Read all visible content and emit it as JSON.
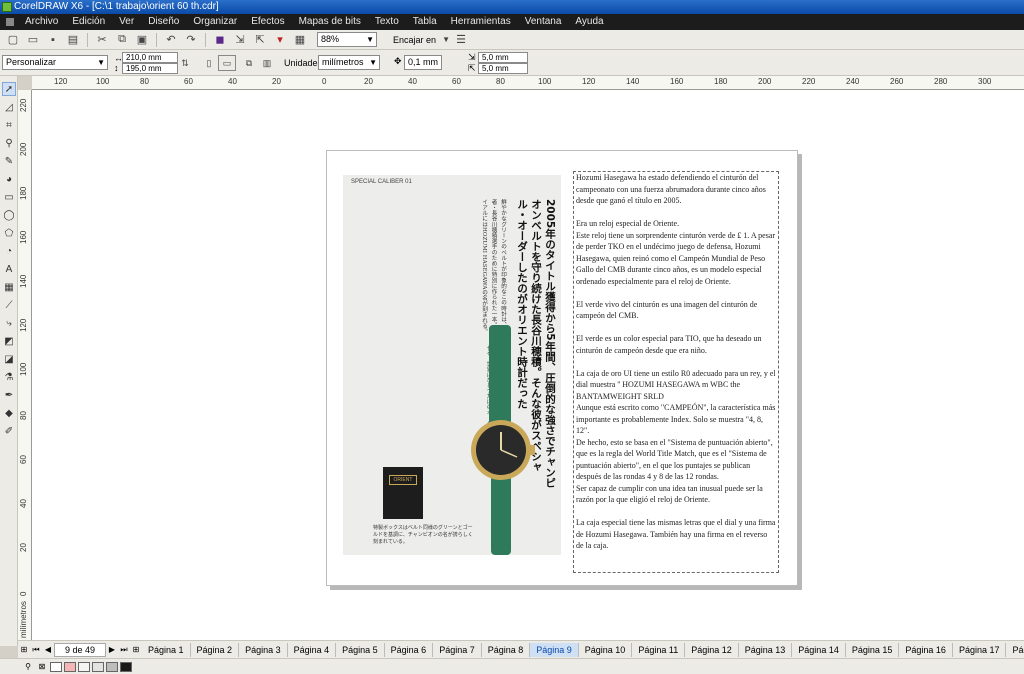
{
  "window": {
    "title": "CorelDRAW X6 - [C:\\1 trabajo\\orient 60 th.cdr]"
  },
  "menu": {
    "items": [
      "Archivo",
      "Edición",
      "Ver",
      "Diseño",
      "Organizar",
      "Efectos",
      "Mapas de bits",
      "Texto",
      "Tabla",
      "Herramientas",
      "Ventana",
      "Ayuda"
    ]
  },
  "toolbar": {
    "zoom": "88%",
    "snap_label": "Encajar en"
  },
  "property_bar": {
    "preset": "Personalizar",
    "width": "210,0 mm",
    "height": "195,0 mm",
    "units_label": "Unidades:",
    "units_value": "milímetros",
    "nudge": "0,1 mm",
    "dup_x": "5,0 mm",
    "dup_y": "5,0 mm"
  },
  "rulers": {
    "h": [
      "120",
      "100",
      "80",
      "60",
      "40",
      "20",
      "0",
      "20",
      "40",
      "60",
      "80",
      "100",
      "120",
      "140",
      "160",
      "180",
      "200",
      "220",
      "240",
      "260",
      "280",
      "300"
    ],
    "v": [
      "220",
      "200",
      "180",
      "160",
      "140",
      "120",
      "100",
      "80",
      "60",
      "40",
      "20",
      "0"
    ],
    "unit": "milímetros"
  },
  "magazine": {
    "header": "SPECIAL CALIBER 01",
    "headline": "2005年のタイトル獲得から5年間、圧倒的な強さでチャンピオンベルトを守り続けた長谷川穂積。そんな彼がスペシャル・オーダーしたのがオリエント時計だった",
    "body1": "鮮やかなグリーンのベルトが印象的なこの時計は、プロボクシング元WBC世界バンタム級王者・長谷川穂積選手のために特別に作られた一本。チャンピオンベルトの色をモチーフに、ダイアルにはHOZUMI HASEGAWAの名が刻まれる。",
    "body2": "CHAMPIONと記されているが、最大の特徴はインデックスだ。8、12は実は1、4、8、12ラウンドを示す公開採点制度に基づくもの。ブランドとボクサーの絆を感じさせる、世界にひとつだけのオーダーメイドである。",
    "card_logo": "ORIENT",
    "caption": "特製ボックスはベルト同様のグリーンとゴールドを基調に、チャンピオンの名が誇らしく刻まれている。"
  },
  "textframe": {
    "paragraphs": [
      "Hozumi Hasegawa ha estado defendiendo el cinturón del campeonato con una fuerza abrumadora durante cinco años desde que ganó el título en 2005.",
      "Era un reloj especial de Oriente.",
      "Este reloj tiene un sorprendente cinturón verde de ₤ 1. A pesar de perder TKO en el undécimo juego de defensa, Hozumi Hasegawa, quien reinó como el Campeón Mundial de Peso Gallo del CMB durante cinco años, es un modelo especial ordenado especialmente para el reloj de Oriente.",
      "El verde vivo del cinturón es una imagen del cinturón de campeón del CMB.",
      "El verde es un color especial para TIO, que ha deseado un cinturón de campeón desde que era niño.",
      "La caja de oro UI tiene un estilo R0 adecuado para un rey, y el dial muestra '' HOZUMI HASEGAWA m WBC the BANTAMWEIGHT SRLD",
      "Aunque está escrito como \"CAMPEÓN\", la característica más importante es probablemente Index. Solo se muestra \"4, 8, 12\".",
      "De hecho, esto se basa en el \"Sistema de puntuación abierto\", que es la regla del World Title Match, que es el \"Sistema de puntuación abierto\", en el que los puntajes se publican después de las rondas 4 y 8 de las 12 rondas.",
      "Ser capaz de cumplir con una idea tan inusual puede ser la razón por la que eligió el reloj de Oriente.",
      "La caja especial tiene las mismas letras que el dial y una firma de Hozumi Hasegawa. También hay una firma en el reverso de la caja."
    ]
  },
  "pages": {
    "counter": "9 de 49",
    "tabs": [
      "Página 1",
      "Página 2",
      "Página 3",
      "Página 4",
      "Página 5",
      "Página 6",
      "Página 7",
      "Página 8",
      "Página 9",
      "Página 10",
      "Página 11",
      "Página 12",
      "Página 13",
      "Página 14",
      "Página 15",
      "Página 16",
      "Página 17",
      "Página 18"
    ],
    "active_index": 8
  },
  "palette": {
    "colors": [
      "#ffffff",
      "#f4b6b6",
      "#f5f5f5",
      "#e3e3e3",
      "#bdbdbd",
      "#1a1a1a"
    ]
  },
  "colors": {
    "title_bar": "#0a4aa8",
    "menu_bar": "#1c1c1c",
    "strap_green": "#2e7a5a",
    "gold": "#c9a85a"
  }
}
